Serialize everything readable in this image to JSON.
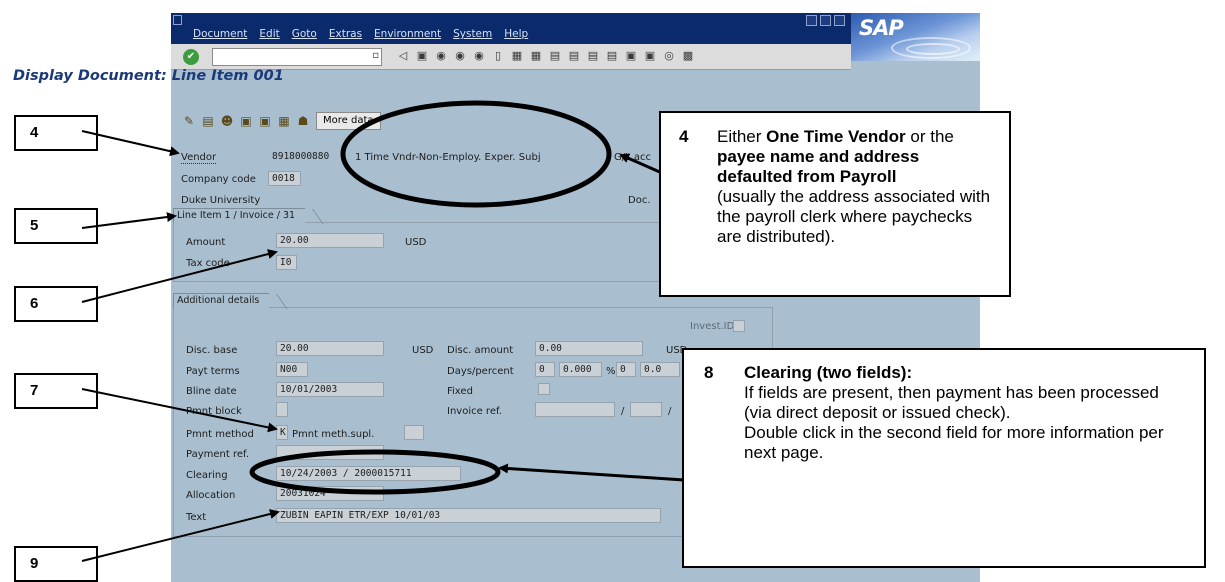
{
  "menu": [
    "Document",
    "Edit",
    "Goto",
    "Extras",
    "Environment",
    "System",
    "Help"
  ],
  "logo": "SAP",
  "screen_title": "Display Document: Line Item 001",
  "app_toolbar": {
    "more_data": "More data"
  },
  "header": {
    "vendor_label": "Vendor",
    "vendor_value": "8918000880",
    "vendor_name": "1 Time Vndr-Non-Employ. Exper. Subj",
    "gl_label": "G/L acc",
    "company_code_label": "Company code",
    "company_code_value": "0018",
    "company_name": "Duke University",
    "doc_label": "Doc."
  },
  "line_item": {
    "tab_label": "Line Item 1 / Invoice / 31",
    "amount_label": "Amount",
    "amount_value": "20.00",
    "amount_currency": "USD",
    "tax_code_label": "Tax code",
    "tax_code_value": "I0"
  },
  "additional": {
    "tab_label": "Additional details",
    "invest_id_label": "Invest.ID",
    "disc_base_label": "Disc. base",
    "disc_base_value": "20.00",
    "disc_base_currency": "USD",
    "disc_amount_label": "Disc. amount",
    "disc_amount_value": "0.00",
    "disc_amount_currency": "USD",
    "payt_terms_label": "Payt terms",
    "payt_terms_value": "N00",
    "days_percent_label": "Days/percent",
    "days_1": "0",
    "pct_1": "0.000",
    "pct_sign": "%",
    "days_2": "0",
    "pct_2": "0.0",
    "bline_date_label": "Bline date",
    "bline_date_value": "10/01/2003",
    "fixed_label": "Fixed",
    "pmnt_block_label": "Pmnt block",
    "invoice_ref_label": "Invoice ref.",
    "slash": "/",
    "pmnt_method_label": "Pmnt method",
    "pmnt_method_value": "K",
    "pmnt_meth_supl_label": "Pmnt meth.supl.",
    "payment_ref_label": "Payment ref.",
    "clearing_label": "Clearing",
    "clearing_value": "10/24/2003 / 2000015711",
    "allocation_label": "Allocation",
    "allocation_value": "20031024",
    "text_label": "Text",
    "text_value": "ZUBIN EAPIN ETR/EXP 10/01/03"
  },
  "callouts": {
    "box_4": "4",
    "box_5": "5",
    "box_6": "6",
    "box_7": "7",
    "box_9": "9",
    "c4_num": "4",
    "c4_t1": "Either ",
    "c4_b1": "One Time Vendor",
    "c4_t2": " or the ",
    "c4_b2": "payee name and address defaulted from Payroll",
    "c4_t3": "(usually the address associated with the payroll clerk where paychecks are distributed).",
    "c8_num": "8",
    "c8_title": "Clearing (two fields):",
    "c8_l1": "If fields are present, then payment has been processed (via direct deposit or issued check).",
    "c8_l2": "Double click in the second field for more information per next page."
  }
}
